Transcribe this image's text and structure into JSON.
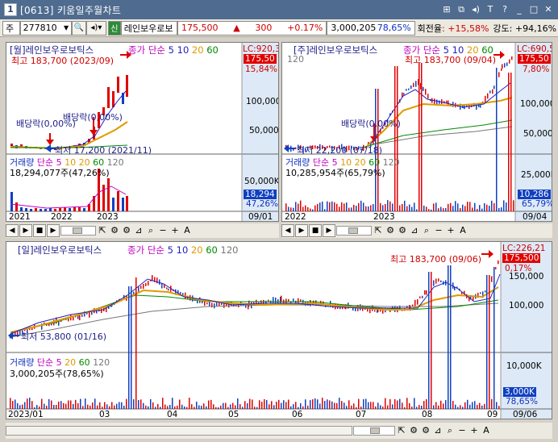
{
  "window": {
    "number": "1",
    "title": "[0613] 키움일주월차트",
    "controls": [
      "link-icon",
      "copy-icon",
      "speaker-icon",
      "text-icon",
      "help-icon",
      "minimize-icon",
      "maximize-icon",
      "close-icon"
    ]
  },
  "toolbar": {
    "market": "주",
    "code": "277810",
    "sin_badge": "신",
    "stock_name": "레인보우로보",
    "price": "175,500",
    "change": "300",
    "change_pct": "+0.17%",
    "volume": "3,000,205",
    "turnover_pct": "78,65%",
    "turnover_label": "회전율",
    "turnover_value": ": +15,58%",
    "strength_label": "강도",
    "strength_value": ": +94,16%"
  },
  "panels": {
    "monthly": {
      "title": "[월]레인보우로보틱스",
      "ma_label": "종가 단순",
      "ma": [
        "5",
        "10",
        "20",
        "60"
      ],
      "lc": "LC:920,3",
      "price_tag": "175,50",
      "pct": "15,84%",
      "high_label": "최고 183,700 (2023/09)",
      "low_label": "최저 17,200 (2021/11)",
      "div1": "배당락(0,00%)",
      "div2": "배당락(0,00%)",
      "yticks": [
        "100,000",
        "50,000"
      ],
      "vol_title": "거래량",
      "vol_ma": [
        "단순 5",
        "10",
        "20",
        "60",
        "120"
      ],
      "vol_value": "18,294,077주(47,26%)",
      "vol_yticks": [
        "50,000K"
      ],
      "vol_tag": "18,294",
      "vol_pct": "47,26%",
      "xlabels": [
        "2021",
        "2022",
        "2023"
      ],
      "date": "09/01"
    },
    "weekly": {
      "title": "[주]레인보우로보틱스",
      "ma_label": "종가 단순",
      "ma": [
        "5",
        "10",
        "20",
        "60"
      ],
      "extra": "120",
      "lc": "LC:690,5",
      "price_tag": "175,50",
      "pct": "7,80%",
      "high_label": "최고 183,700 (09/04)",
      "low_label": "최저 22,200 (07/18)",
      "div1": "배당락(0,00%)",
      "yticks": [
        "100,000",
        "50,000"
      ],
      "vol_title": "거래량",
      "vol_ma": [
        "단순 5",
        "10",
        "20",
        "60",
        "120"
      ],
      "vol_value": "10,285,954주(65,79%)",
      "vol_yticks": [
        "25,000K"
      ],
      "vol_tag": "10,286",
      "vol_pct": "65,79%",
      "xlabels": [
        "2022",
        "2023"
      ],
      "date": "09/04"
    },
    "daily": {
      "title": "[일]레인보우로보틱스",
      "ma_label": "종가 단순",
      "ma": [
        "5",
        "10",
        "20",
        "60",
        "120"
      ],
      "lc": "LC:226,21",
      "price_tag": "175,500",
      "pct": "0,17%",
      "high_label": "최고 183,700 (09/06)",
      "low_label": "최저 53,800 (01/16)",
      "yticks": [
        "150,000",
        "100,000"
      ],
      "vol_title": "거래량",
      "vol_ma": [
        "단순 5",
        "20",
        "60",
        "120"
      ],
      "vol_value": "3,000,205주(78,65%)",
      "vol_yticks": [
        "10,000K"
      ],
      "vol_tag": "3,000K",
      "vol_pct": "78,65%",
      "xlabels": [
        "2023/01",
        "03",
        "04",
        "05",
        "06",
        "07",
        "08",
        "09"
      ],
      "date": "09/06"
    }
  },
  "colors": {
    "up": "#e00000",
    "down": "#1040c0",
    "ma5": "#2020c0",
    "ma20": "#e09a00",
    "ma60": "#008a00",
    "ma120": "#777777"
  }
}
